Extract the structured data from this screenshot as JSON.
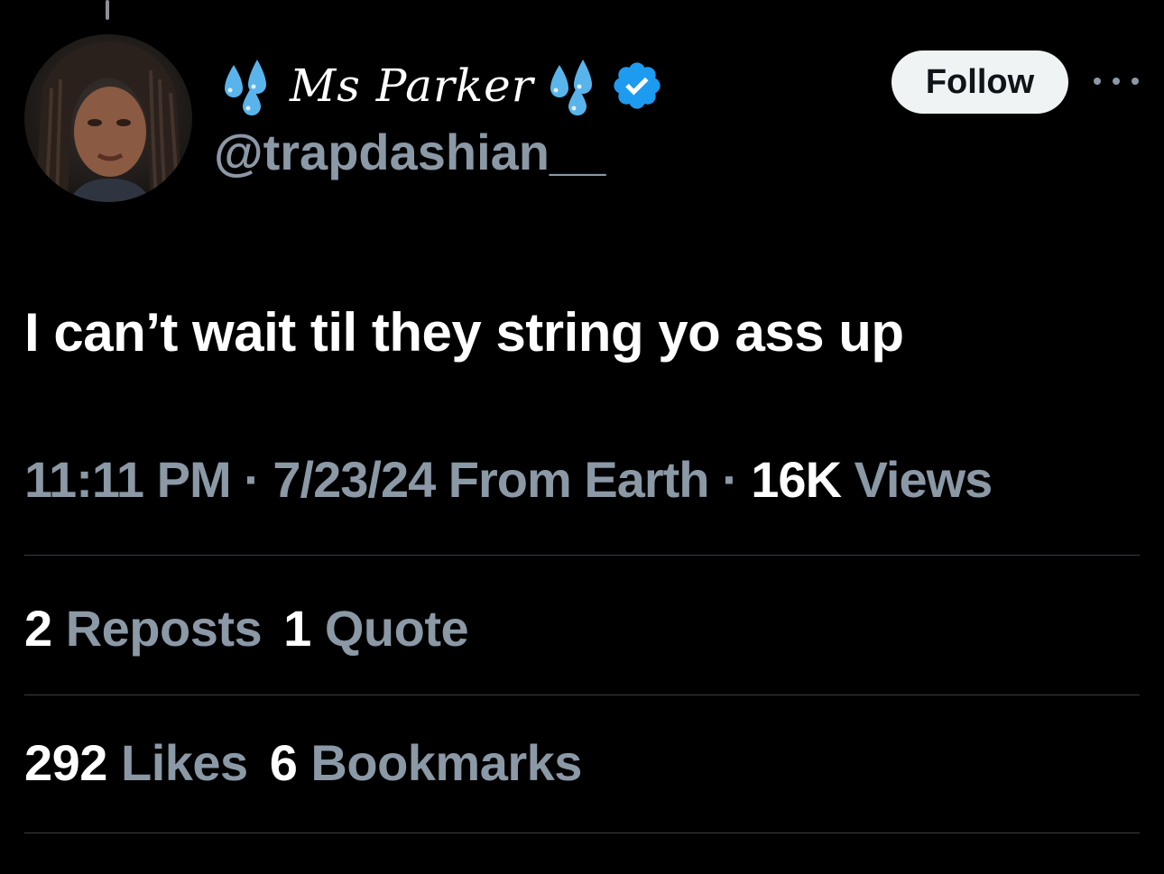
{
  "tweet": {
    "author": {
      "display_name": "Ms Parker",
      "name_emoji": "sweat-droplets-icon",
      "handle": "@trapdashian__",
      "verified": true
    },
    "follow_label": "Follow",
    "more_icon": "more-horizontal-icon",
    "text": "I can’t wait til they string yo ass up",
    "time": "11:11 PM",
    "separator": "·",
    "date": "7/23/24",
    "source": "From Earth",
    "views_count": "16K",
    "views_label": "Views",
    "reposts_count": "2",
    "reposts_label": "Reposts",
    "quotes_count": "1",
    "quotes_label": "Quote",
    "likes_count": "292",
    "likes_label": "Likes",
    "bookmarks_count": "6",
    "bookmarks_label": "Bookmarks"
  },
  "colors": {
    "background": "#000000",
    "primary_text": "#ffffff",
    "secondary_text": "#8b98a5",
    "divider": "#3a3d41",
    "verified_badge": "#1d9bf0",
    "follow_button_bg": "#eff3f4",
    "droplet_blue": "#5ab4ec"
  }
}
